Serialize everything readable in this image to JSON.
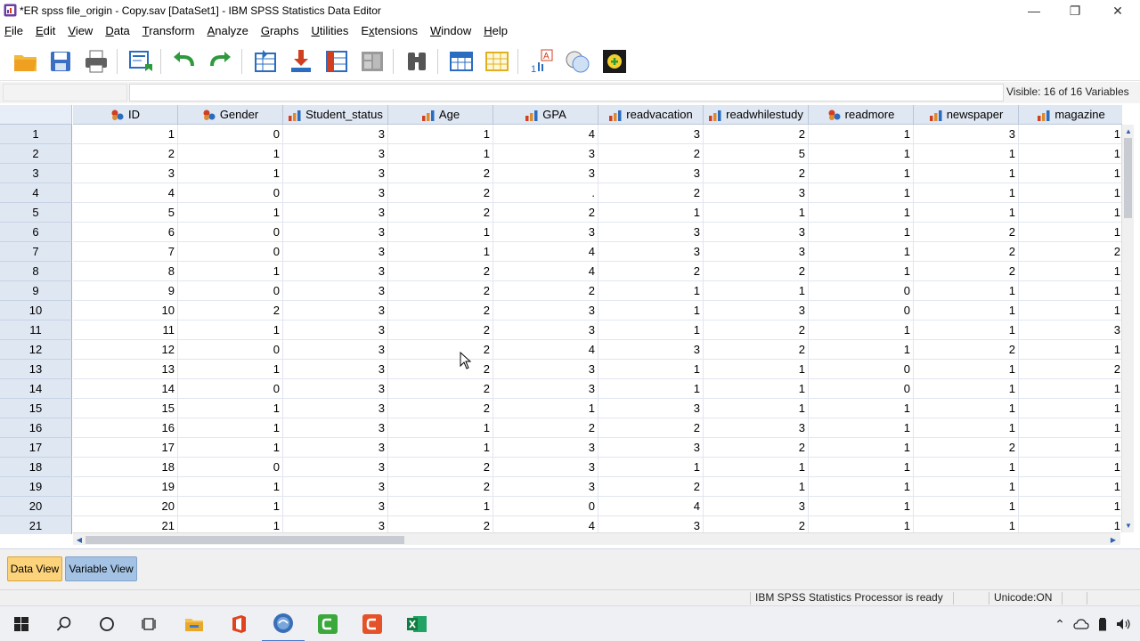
{
  "window": {
    "title": "*ER spss file_origin - Copy.sav [DataSet1] - IBM SPSS Statistics Data Editor",
    "minimize_label": "—",
    "restore_label": "❐",
    "close_label": "✕"
  },
  "menu": [
    {
      "label": "File",
      "underline": "F",
      "rest": "ile"
    },
    {
      "label": "Edit",
      "underline": "E",
      "rest": "dit"
    },
    {
      "label": "View",
      "underline": "V",
      "rest": "iew"
    },
    {
      "label": "Data",
      "underline": "D",
      "rest": "ata"
    },
    {
      "label": "Transform",
      "underline": "T",
      "rest": "ransform"
    },
    {
      "label": "Analyze",
      "underline": "A",
      "rest": "nalyze"
    },
    {
      "label": "Graphs",
      "underline": "G",
      "rest": "raphs"
    },
    {
      "label": "Utilities",
      "underline": "U",
      "rest": "tilities"
    },
    {
      "label": "Extensions",
      "underline": "x",
      "rest_pre": "E",
      "rest": "tensions"
    },
    {
      "label": "Window",
      "underline": "W",
      "rest": "indow"
    },
    {
      "label": "Help",
      "underline": "H",
      "rest": "elp"
    }
  ],
  "toolbar": {
    "buttons": [
      {
        "name": "open-data-icon",
        "color": "#f0a020"
      },
      {
        "name": "save-icon",
        "color": "#3a6fc4"
      },
      {
        "name": "print-icon",
        "color": "#606060"
      },
      {
        "name": "recall-dialog-icon",
        "color": "#2a6cc0"
      },
      {
        "name": "undo-icon",
        "color": "#2e9a3c"
      },
      {
        "name": "redo-icon",
        "color": "#2e9a3c"
      },
      {
        "name": "go-to-case-icon",
        "color": "#2a6cc0"
      },
      {
        "name": "go-to-variable-icon",
        "color": "#d04020"
      },
      {
        "name": "variables-icon",
        "color": "#2a6cc0"
      },
      {
        "name": "run-descriptives-icon",
        "color": "#9a9a9a"
      },
      {
        "name": "find-icon",
        "color": "#555555"
      },
      {
        "name": "insert-cases-icon",
        "color": "#2a6cc0"
      },
      {
        "name": "insert-variable-icon",
        "color": "#e0b020"
      },
      {
        "name": "split-file-icon",
        "color": "#d04020"
      },
      {
        "name": "select-cases-icon",
        "color": "#5b8fd8"
      },
      {
        "name": "value-labels-icon",
        "color": "#2e9a3c"
      }
    ]
  },
  "editor": {
    "cell_name": "",
    "cell_value": "",
    "visible_label": "Visible: 16 of 16 Variables"
  },
  "columns": [
    {
      "name": "ID",
      "icon": "nominal-icon"
    },
    {
      "name": "Gender",
      "icon": "nominal-icon"
    },
    {
      "name": "Student_status",
      "icon": "ordinal-icon"
    },
    {
      "name": "Age",
      "icon": "ordinal-icon"
    },
    {
      "name": "GPA",
      "icon": "ordinal-icon"
    },
    {
      "name": "readvacation",
      "icon": "ordinal-icon"
    },
    {
      "name": "readwhilestudy",
      "icon": "ordinal-icon"
    },
    {
      "name": "readmore",
      "icon": "nominal-icon"
    },
    {
      "name": "newspaper",
      "icon": "ordinal-icon"
    },
    {
      "name": "magazine",
      "icon": "ordinal-icon"
    }
  ],
  "rows": [
    {
      "n": "1",
      "cells": [
        "1",
        "0",
        "3",
        "1",
        "4",
        "3",
        "2",
        "1",
        "3",
        "1"
      ]
    },
    {
      "n": "2",
      "cells": [
        "2",
        "1",
        "3",
        "1",
        "3",
        "2",
        "5",
        "1",
        "1",
        "1"
      ]
    },
    {
      "n": "3",
      "cells": [
        "3",
        "1",
        "3",
        "2",
        "3",
        "3",
        "2",
        "1",
        "1",
        "1"
      ]
    },
    {
      "n": "4",
      "cells": [
        "4",
        "0",
        "3",
        "2",
        ".",
        "2",
        "3",
        "1",
        "1",
        "1"
      ]
    },
    {
      "n": "5",
      "cells": [
        "5",
        "1",
        "3",
        "2",
        "2",
        "1",
        "1",
        "1",
        "1",
        "1"
      ]
    },
    {
      "n": "6",
      "cells": [
        "6",
        "0",
        "3",
        "1",
        "3",
        "3",
        "3",
        "1",
        "2",
        "1"
      ]
    },
    {
      "n": "7",
      "cells": [
        "7",
        "0",
        "3",
        "1",
        "4",
        "3",
        "3",
        "1",
        "2",
        "2"
      ]
    },
    {
      "n": "8",
      "cells": [
        "8",
        "1",
        "3",
        "2",
        "4",
        "2",
        "2",
        "1",
        "2",
        "1"
      ]
    },
    {
      "n": "9",
      "cells": [
        "9",
        "0",
        "3",
        "2",
        "2",
        "1",
        "1",
        "0",
        "1",
        "1"
      ]
    },
    {
      "n": "10",
      "cells": [
        "10",
        "2",
        "3",
        "2",
        "3",
        "1",
        "3",
        "0",
        "1",
        "1"
      ]
    },
    {
      "n": "11",
      "cells": [
        "11",
        "1",
        "3",
        "2",
        "3",
        "1",
        "2",
        "1",
        "1",
        "3"
      ]
    },
    {
      "n": "12",
      "cells": [
        "12",
        "0",
        "3",
        "2",
        "4",
        "3",
        "2",
        "1",
        "2",
        "1"
      ]
    },
    {
      "n": "13",
      "cells": [
        "13",
        "1",
        "3",
        "2",
        "3",
        "1",
        "1",
        "0",
        "1",
        "2"
      ]
    },
    {
      "n": "14",
      "cells": [
        "14",
        "0",
        "3",
        "2",
        "3",
        "1",
        "1",
        "0",
        "1",
        "1"
      ]
    },
    {
      "n": "15",
      "cells": [
        "15",
        "1",
        "3",
        "2",
        "1",
        "3",
        "1",
        "1",
        "1",
        "1"
      ]
    },
    {
      "n": "16",
      "cells": [
        "16",
        "1",
        "3",
        "1",
        "2",
        "2",
        "3",
        "1",
        "1",
        "1"
      ]
    },
    {
      "n": "17",
      "cells": [
        "17",
        "1",
        "3",
        "1",
        "3",
        "3",
        "2",
        "1",
        "2",
        "1"
      ]
    },
    {
      "n": "18",
      "cells": [
        "18",
        "0",
        "3",
        "2",
        "3",
        "1",
        "1",
        "1",
        "1",
        "1"
      ]
    },
    {
      "n": "19",
      "cells": [
        "19",
        "1",
        "3",
        "2",
        "3",
        "2",
        "1",
        "1",
        "1",
        "1"
      ]
    },
    {
      "n": "20",
      "cells": [
        "20",
        "1",
        "3",
        "1",
        "0",
        "4",
        "3",
        "1",
        "1",
        "1"
      ]
    },
    {
      "n": "21",
      "cells": [
        "21",
        "1",
        "3",
        "2",
        "4",
        "3",
        "2",
        "1",
        "1",
        "1"
      ]
    }
  ],
  "tabs": {
    "data_view": "Data View",
    "variable_view": "Variable View"
  },
  "status": {
    "processor": "IBM SPSS Statistics Processor is ready",
    "unicode": "Unicode:ON"
  },
  "taskbar": {
    "items": [
      "start-icon",
      "search-icon",
      "cortana-icon",
      "task-view-icon",
      "file-explorer-icon",
      "office-icon",
      "spss-icon",
      "camtasia-icon",
      "camtasia-recorder-icon",
      "excel-icon"
    ]
  },
  "colors": {
    "header_bg": "#dfe7f3",
    "active_tab": "#fcd27a",
    "inactive_tab": "#a4c3e4",
    "accent": "#4a7bd0"
  }
}
